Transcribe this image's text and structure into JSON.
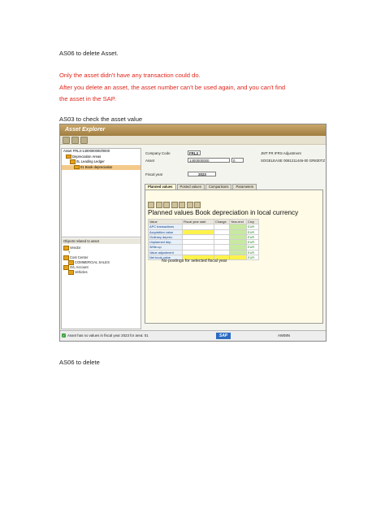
{
  "doc": {
    "heading1": "AS06 to delete Asset.",
    "warning_line1": "Only the asset didn't have any transaction could do.",
    "warning_line2": "After you delete an asset, the asset number can't be used again, and you can't find",
    "warning_line3": "the asset in the SAP.",
    "heading2": "AS03 to check the asset value",
    "heading3": "AS06 to delete"
  },
  "sap": {
    "window_title": "Asset Explorer",
    "tree": {
      "root": "Asset FRL3-1400000000/0000",
      "items": [
        "Depreciation Areas",
        "0L Leading Ledger",
        "01 Book depreciation"
      ]
    },
    "objects_header": "Objects related to asset",
    "objects": [
      "Vendor",
      "?",
      "Cost Center",
      "COMMERCIAL SALES",
      "G/L Account",
      "Vehicles"
    ],
    "fields": {
      "company_code_label": "Company Code",
      "company_code_value": "FRL3",
      "company_code_desc": "JMT FR IFRS Adjustment",
      "asset_label": "Asset",
      "asset_value": "1400000000",
      "asset_sub": "0",
      "asset_desc": "SOGELEASE 0081211446-00 GR830TZ",
      "fiscal_year_label": "Fiscal year",
      "fiscal_year_value": "2023"
    },
    "tabs": [
      "Planned values",
      "Posted values",
      "Comparisons",
      "Parameters"
    ],
    "panel_title": "Planned values Book depreciation in local currency",
    "table": {
      "headers": [
        "Value",
        "Fiscal year start",
        "Change",
        "Year-end",
        "Crcy"
      ],
      "rows": [
        {
          "label": "APC transactions",
          "crcy": "EUR"
        },
        {
          "label": "Acquisition value",
          "crcy": "EUR"
        },
        {
          "label": "Ordinary deprec.",
          "crcy": "EUR"
        },
        {
          "label": "Unplanned dep.",
          "crcy": "EUR"
        },
        {
          "label": "Write-up",
          "crcy": "EUR"
        },
        {
          "label": "Value adjustment",
          "crcy": "EUR"
        },
        {
          "label": "Net book value",
          "crcy": "EUR"
        }
      ]
    },
    "no_postings": "No postings for selected fiscal year",
    "status_message": "Asset has no values in fiscal year 2023 for area: 01",
    "sap_logo": "SAP",
    "status_right": "AW08N"
  }
}
